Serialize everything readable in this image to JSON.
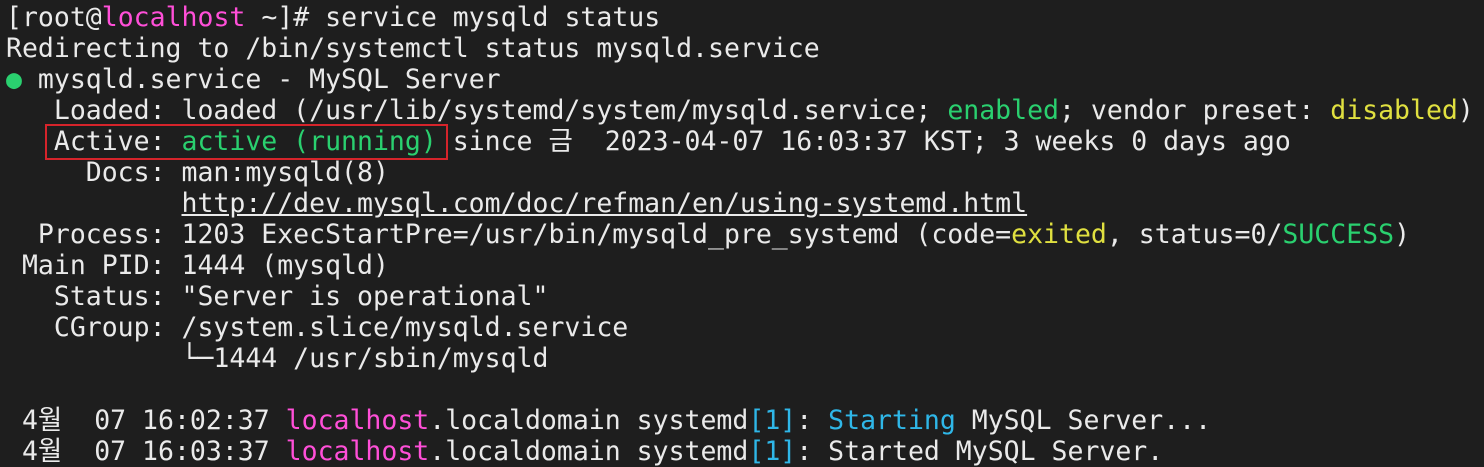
{
  "prompt": {
    "bracket_open": "[",
    "user": "root",
    "at": "@",
    "host": "localhost",
    "rest": " ~]# ",
    "command": "service mysqld status"
  },
  "output": {
    "redirect": "Redirecting to /bin/systemctl status mysqld.service",
    "dot": "●",
    "service_title": " mysqld.service - MySQL Server",
    "loaded_label": "   Loaded: ",
    "loaded_value": "loaded (/usr/lib/systemd/system/mysqld.service; ",
    "loaded_enabled": "enabled",
    "loaded_mid": "; vendor preset: ",
    "loaded_disabled": "disabled",
    "loaded_end": ")",
    "active_label": "   Active: ",
    "active_value": "active (running)",
    "active_rest": " since 금  2023-04-07 16:03:37 KST; 3 weeks 0 days ago",
    "docs_label": "     Docs: ",
    "docs_man": "man:mysqld(8)",
    "docs_indent": "           ",
    "docs_url": "http://dev.mysql.com/doc/refman/en/using-systemd.html",
    "process_label": "  Process: ",
    "process_value": "1203 ExecStartPre=/usr/bin/mysqld_pre_systemd (code=",
    "process_exited": "exited",
    "process_mid": ", status=0/",
    "process_success": "SUCCESS",
    "process_end": ")",
    "mainpid_label": " Main PID: ",
    "mainpid_value": "1444 (mysqld)",
    "status_label": "   Status: ",
    "status_value": "\"Server is operational\"",
    "cgroup_label": "   CGroup: ",
    "cgroup_value": "/system.slice/mysqld.service",
    "cgroup_child_indent": "           ",
    "cgroup_child": "└─1444 /usr/sbin/mysqld"
  },
  "logs": [
    {
      "date": " 4월  07 16:02:37 ",
      "host": "localhost",
      "domain": ".localdomain systemd",
      "bracket_open": "[",
      "pid": "1",
      "bracket_close": "]",
      "colon": ": ",
      "verb": "Starting",
      "message": " MySQL Server..."
    },
    {
      "date": " 4월  07 16:03:37 ",
      "host": "localhost",
      "domain": ".localdomain systemd",
      "bracket_open": "[",
      "pid": "1",
      "bracket_close": "]",
      "colon": ": ",
      "verb": "",
      "message": "Started MySQL Server."
    }
  ],
  "colors": {
    "background": "#1e1e1e",
    "foreground": "#eaeaea",
    "magenta": "#ff4fd8",
    "green": "#2ad06f",
    "yellow": "#e0e040",
    "cyan": "#2fb7e8",
    "highlight_box": "#d6242b"
  }
}
